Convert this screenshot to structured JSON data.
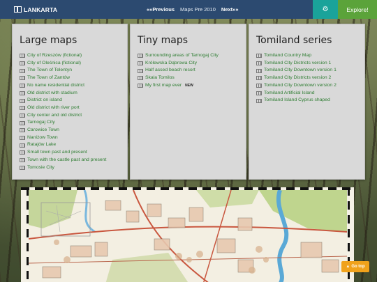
{
  "navbar": {
    "brand": "LANKARTA",
    "previous_label": "««Previous",
    "current_label": "Maps Pre 2010",
    "next_label": "Next»»",
    "settings_icon": "gear-icon",
    "explore_label": "Explore!",
    "colors": {
      "bar": "#2c4a70",
      "settings": "#1aa39a",
      "explore": "#5ba33a"
    }
  },
  "cards": [
    {
      "title": "Large maps",
      "items": [
        "City of Rzeszów (fictional)",
        "City of Oleśnica (fictional)",
        "The Town of Telentyn",
        "The Town of Zantów",
        "No name residential district",
        "Old district with stadium",
        "District on island",
        "Old district with river port",
        "City center and old district",
        "Tarnogaj City",
        "Carowice Town",
        "Naniżow Town",
        "Ratajów Lake",
        "Small town past and present",
        "Town with the castle past and present",
        "Tomosie City"
      ]
    },
    {
      "title": "Tiny maps",
      "items": [
        "Surrounding areas of Tarnogaj City",
        "Królewska Dąbrowa City",
        "Half assed beach resort",
        "Skala Tomilos",
        "My first map ever"
      ],
      "new_badge": "NEW"
    },
    {
      "title": "Tomiland series",
      "items": [
        "Tomiland Country Map",
        "Tomiland City Districts version 1",
        "Tomiland City Downtown version 1",
        "Tomiland City Districts version 2",
        "Tomiland City Downtown version 2",
        "Tomiland Artificial Island",
        "Tomiland Island Cyprus shaped"
      ]
    }
  ],
  "link_color": "#2e7d32",
  "go_top_label": "Go top",
  "go_top_icon": "arrow-up-icon"
}
